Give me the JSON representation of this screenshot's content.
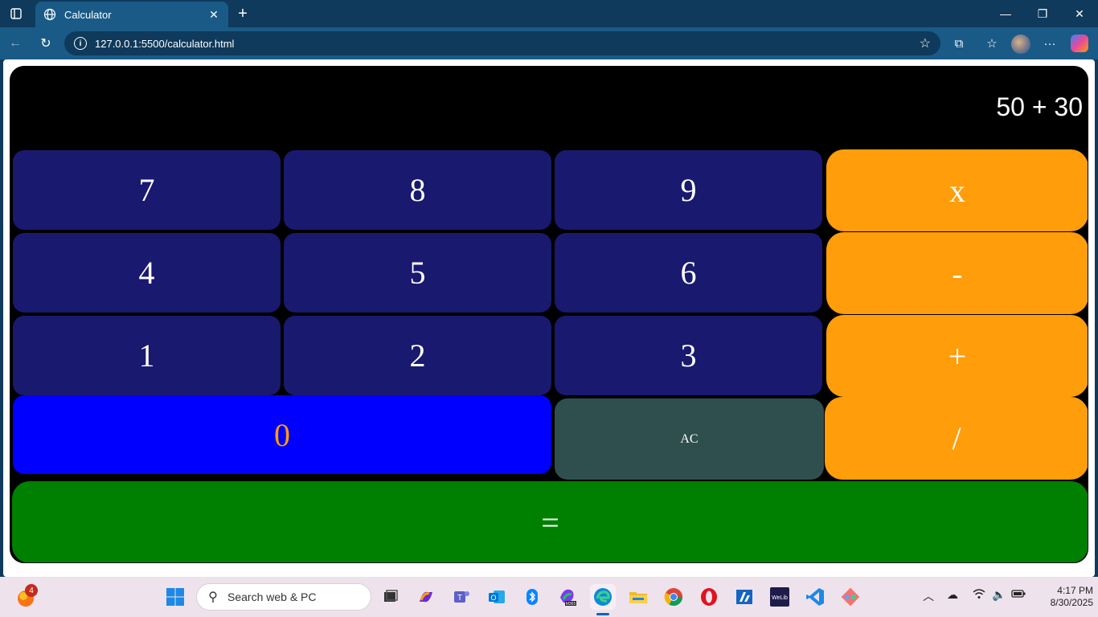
{
  "browser": {
    "tab_title": "Calculator",
    "tab_close": "✕",
    "new_tab": "+",
    "url": "127.0.0.1:5500/calculator.html",
    "window_controls": {
      "minimize": "—",
      "restore": "❐",
      "close": "✕"
    }
  },
  "calculator": {
    "display": "50 + 30",
    "keys": {
      "k7": "7",
      "k8": "8",
      "k9": "9",
      "multiply": "x",
      "k4": "4",
      "k5": "5",
      "k6": "6",
      "minus": "-",
      "k1": "1",
      "k2": "2",
      "k3": "3",
      "plus": "+",
      "k0": "0",
      "ac": "AC",
      "divide": "/",
      "equals": "="
    },
    "colors": {
      "number_key": "#191970",
      "operator_key": "#ff9d0a",
      "zero_key": "#0000ff",
      "ac_key": "#2f4f4f",
      "equals_key": "#008000",
      "background": "#000000"
    }
  },
  "taskbar": {
    "search_placeholder": "Search web & PC",
    "notification_count": "4",
    "clock_time": "4:17 PM",
    "clock_date": "8/30/2025",
    "apps": [
      "Start",
      "Task View",
      "Copilot",
      "Teams",
      "Outlook",
      "Bluetooth",
      "Microsoft 365",
      "Edge",
      "File Explorer",
      "Chrome",
      "Opera",
      "Azure",
      "WeLib",
      "VS Code",
      "Git Tool"
    ]
  }
}
